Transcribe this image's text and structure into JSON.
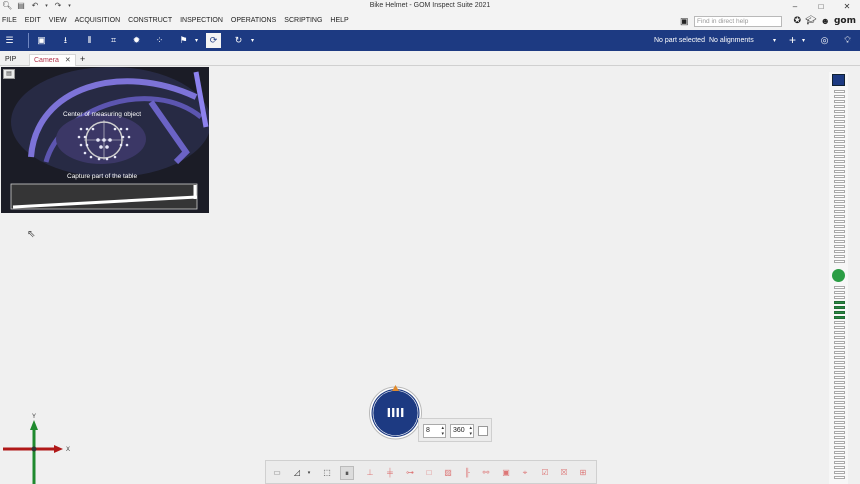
{
  "window": {
    "title": "Bike Helmet - GOM Inspect Suite 2021",
    "controls": [
      "–",
      "□",
      "✕"
    ]
  },
  "menu": {
    "items": [
      "FILE",
      "EDIT",
      "VIEW",
      "ACQUISITION",
      "CONSTRUCT",
      "INSPECTION",
      "OPERATIONS",
      "SCRIPTING",
      "HELP"
    ],
    "search_placeholder": "Find in direct help",
    "logo": "gom"
  },
  "toolbar": {
    "part_status": "No part selected",
    "alignment_status": "No alignments",
    "add_label": "+"
  },
  "tabs": {
    "pip": "PIP",
    "camera": "Camera",
    "close": "✕",
    "add": "+"
  },
  "pip": {
    "label_center": "Center of measuring object",
    "label_table": "Capture part of the table"
  },
  "axis": {
    "x": "X",
    "y": "Y"
  },
  "rotation": {
    "steps": "8",
    "degrees": "360",
    "dial_icon": "IIII"
  },
  "colors": {
    "toolbar_blue": "#1d3a82",
    "tab_active_text": "#b2344c",
    "status_green": "#2a9d44",
    "axis_red": "#b01818",
    "axis_green": "#1f8a2e"
  }
}
